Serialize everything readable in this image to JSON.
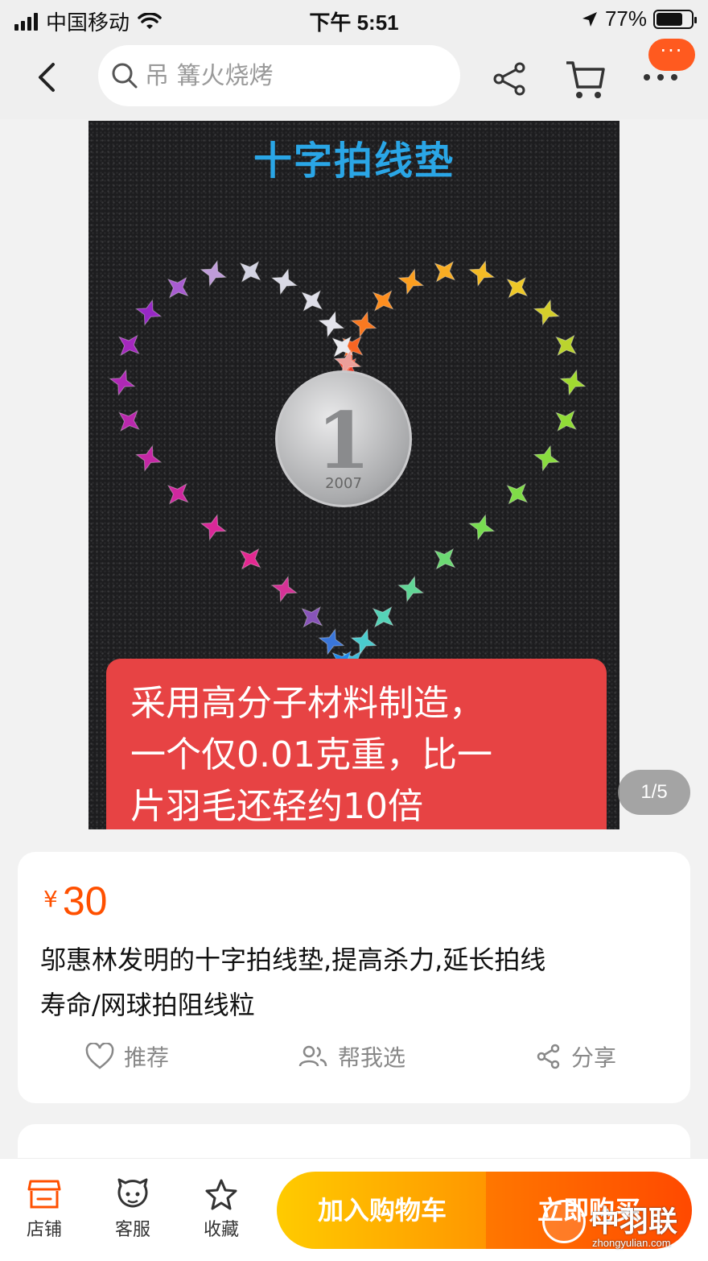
{
  "status_bar": {
    "carrier": "中国移动",
    "time": "下午 5:51",
    "battery": "77%",
    "battery_level": 0.77
  },
  "header": {
    "search_placeholder": "吊 篝火烧烤",
    "icons": [
      "back-icon",
      "search-icon",
      "share-icon",
      "cart-icon",
      "more-icon"
    ],
    "more_badge": "···"
  },
  "gallery": {
    "image_title": "十字拍线垫",
    "caption_lines": [
      "采用高分子材料制造，",
      "一个仅0.01克重，比一",
      "片羽毛还轻约10倍"
    ],
    "coin_text": "1",
    "coin_year": "2007",
    "pager": "1/5"
  },
  "product": {
    "currency": "¥",
    "price": "30",
    "title_line1": "邬惠林发明的十字拍线垫,提高杀力,延长拍线",
    "title_line2": "寿命/网球拍阻线粒",
    "actions": {
      "recommend": "推荐",
      "help_choose": "帮我选",
      "share": "分享"
    }
  },
  "bottom_bar": {
    "store": "店铺",
    "service": "客服",
    "favorite": "收藏",
    "add_to_cart": "加入购物车",
    "buy_now": "立即购买"
  },
  "watermark": {
    "name": "中羽联",
    "url": "zhongyulian.com"
  },
  "colors": {
    "accent": "#ff5000",
    "cart_button": "#ffb300",
    "buy_button": "#ff5a00",
    "caption_bg": "#e74344",
    "title_blue": "#2aa6e6"
  }
}
